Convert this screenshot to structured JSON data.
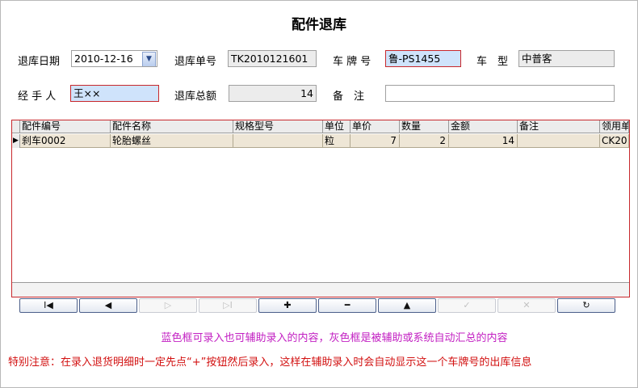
{
  "title": "配件退库",
  "form": {
    "return_date_label": "退库日期",
    "return_date_value": "2010-12-16",
    "return_no_label": "退库单号",
    "return_no_value": "TK2010121601",
    "plate_label": "车 牌 号",
    "plate_value": "鲁-PS1455",
    "model_label": "车　型",
    "model_value": "中普客",
    "handler_label": "经 手 人",
    "handler_value": "王××",
    "total_label": "退库总额",
    "total_value": "14",
    "remark_label": "备　注",
    "remark_value": ""
  },
  "grid": {
    "columns": [
      "配件编号",
      "配件名称",
      "规格型号",
      "单位",
      "单价",
      "数量",
      "金额",
      "备注",
      "领用单"
    ],
    "rows": [
      [
        "刹车0002",
        "轮胎螺丝",
        "",
        "粒",
        "7",
        "2",
        "14",
        "",
        "CK20"
      ]
    ]
  },
  "nav": {
    "first": "I◀",
    "prev": "◀",
    "next": "▷",
    "last": "▷I",
    "add": "✚",
    "delete": "━",
    "up": "▲",
    "confirm": "✓",
    "cancel": "✕",
    "refresh": "↻"
  },
  "notes": {
    "hint": "蓝色框可录入也可辅助录入的内容，灰色框是被辅助或系统自动汇总的内容",
    "warning": "特别注意：在录入退货明细时一定先点“+”按钮然后录入，这样在辅助录入时会自动显示这一个车牌号的出库信息"
  },
  "colors": {
    "editable_blue": "#cfe3fb",
    "auto_gray": "#ececec",
    "highlight_red": "#c8282c",
    "hint_magenta": "#c21fc2",
    "warning_red": "#d21010"
  }
}
